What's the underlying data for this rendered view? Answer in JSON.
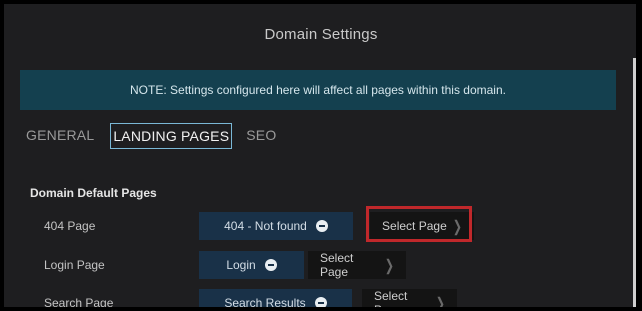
{
  "modal": {
    "title": "Domain Settings"
  },
  "notice": {
    "text": "NOTE: Settings configured here will affect all pages within this domain."
  },
  "tabs": [
    {
      "label": "GENERAL",
      "active": false
    },
    {
      "label": "LANDING PAGES",
      "active": true
    },
    {
      "label": "SEO",
      "active": false
    }
  ],
  "section": {
    "heading": "Domain Default Pages"
  },
  "rows": [
    {
      "label": "404 Page",
      "page": "404 - Not found",
      "select_label": "Select Page"
    },
    {
      "label": "Login Page",
      "page": "Login",
      "select_label": "Select Page"
    },
    {
      "label": "Search Page",
      "page": "Search Results",
      "select_label": "Select Page"
    }
  ],
  "colors": {
    "highlight": "#c0282b",
    "notice_bg": "#14404f",
    "pill_bg": "#193148",
    "active_tab_border": "#7ab8d6"
  },
  "icons": {
    "remove": "minus-circle-icon",
    "select": "chevron-right-icon"
  }
}
